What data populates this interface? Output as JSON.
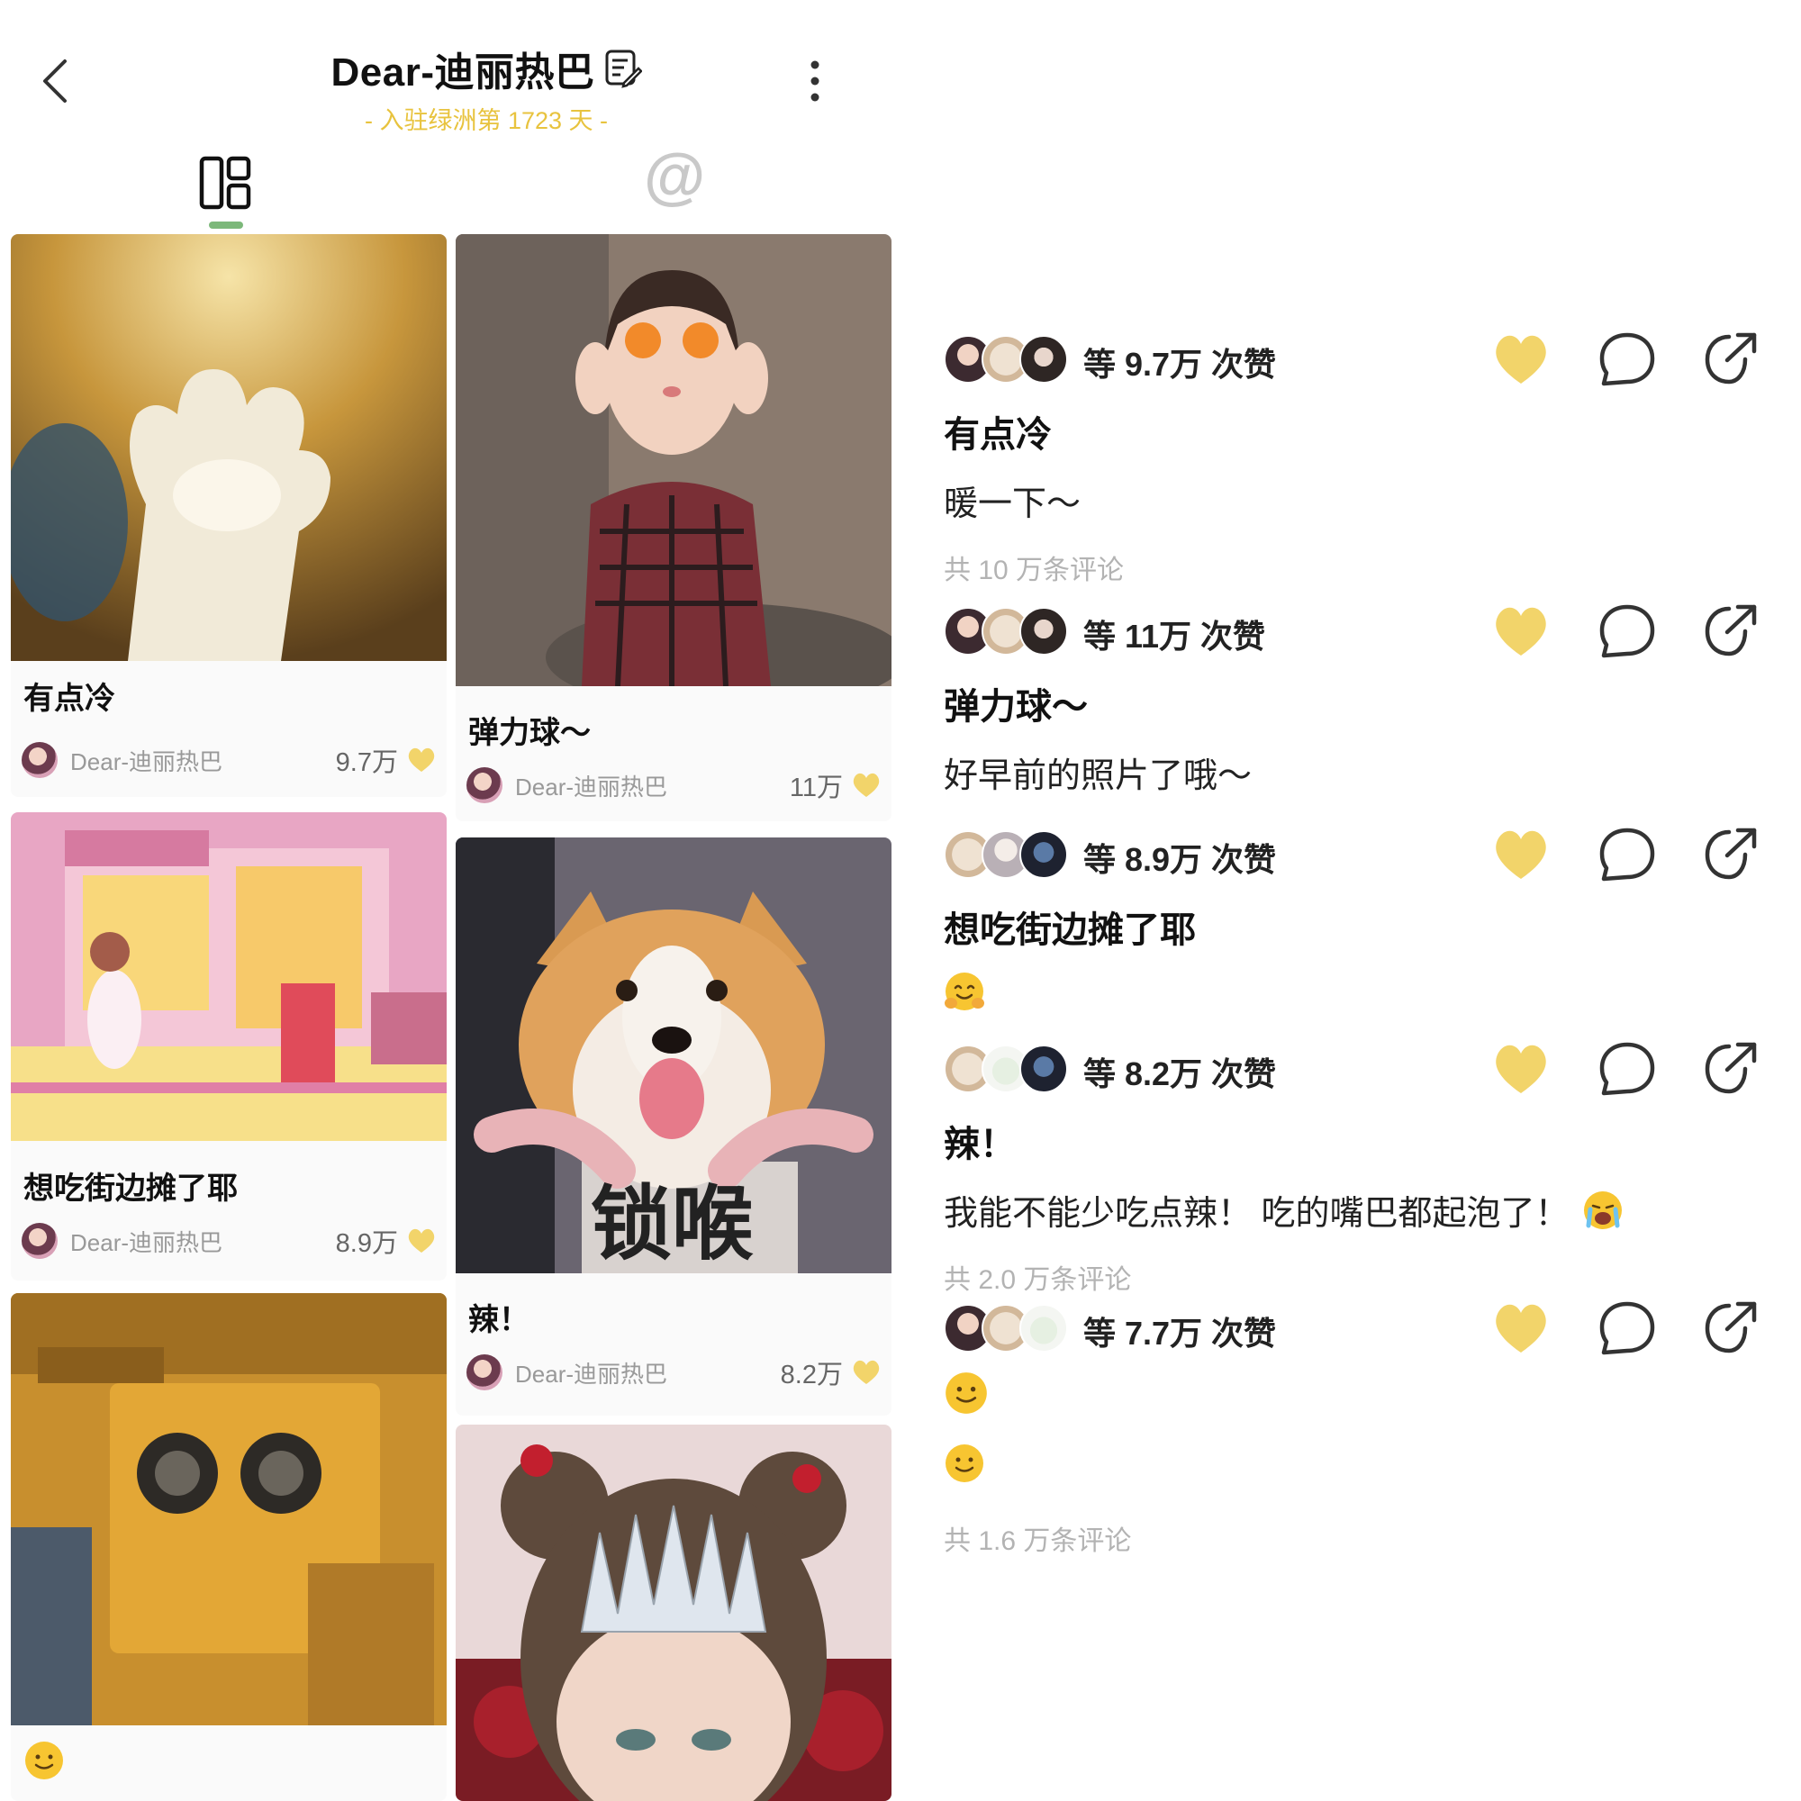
{
  "header": {
    "back_icon": "chevron-left-icon",
    "title": "Dear-迪丽热巴",
    "title_icon": "note-edit-icon",
    "subtitle": "- 入驻绿洲第 1723 天 -",
    "more_icon": "more-vertical-icon"
  },
  "tabs": {
    "grid_icon": "grid-layout-icon",
    "mention_label": "@"
  },
  "colors": {
    "accent_yellow": "#e8c33e",
    "heart": "#f2d46a",
    "tab_indicator": "#7cb87a"
  },
  "cards": [
    {
      "title": "有点冷",
      "author": "Dear-迪丽热巴",
      "likes": "9.7万"
    },
    {
      "title": "弹力球～",
      "author": "Dear-迪丽热巴",
      "likes": "11万"
    },
    {
      "title": "想吃街边摊了耶",
      "author": "Dear-迪丽热巴",
      "likes": "8.9万"
    },
    {
      "title": "辣！",
      "author": "Dear-迪丽热巴",
      "likes": "8.2万",
      "image_text": "锁喉"
    },
    {
      "title": "",
      "author": "",
      "likes": ""
    },
    {
      "title": "",
      "author": "",
      "likes": ""
    }
  ],
  "feed": [
    {
      "likes_text": "等 9.7万 次赞",
      "title": "有点冷",
      "body": "暖一下～",
      "comments": "共 10 万条评论"
    },
    {
      "likes_text": "等 11万 次赞",
      "title": "弹力球～",
      "body": "好早前的照片了哦～",
      "comments": ""
    },
    {
      "likes_text": "等 8.9万 次赞",
      "title": "想吃街边摊了耶",
      "body": "",
      "comments": ""
    },
    {
      "likes_text": "等 8.2万 次赞",
      "title": "辣！",
      "body": "我能不能少吃点辣！ 吃的嘴巴都起泡了！",
      "comments": "共 2.0 万条评论"
    },
    {
      "likes_text": "等 7.7万 次赞",
      "title": "",
      "body": "",
      "comments": "共 1.6 万条评论"
    }
  ]
}
